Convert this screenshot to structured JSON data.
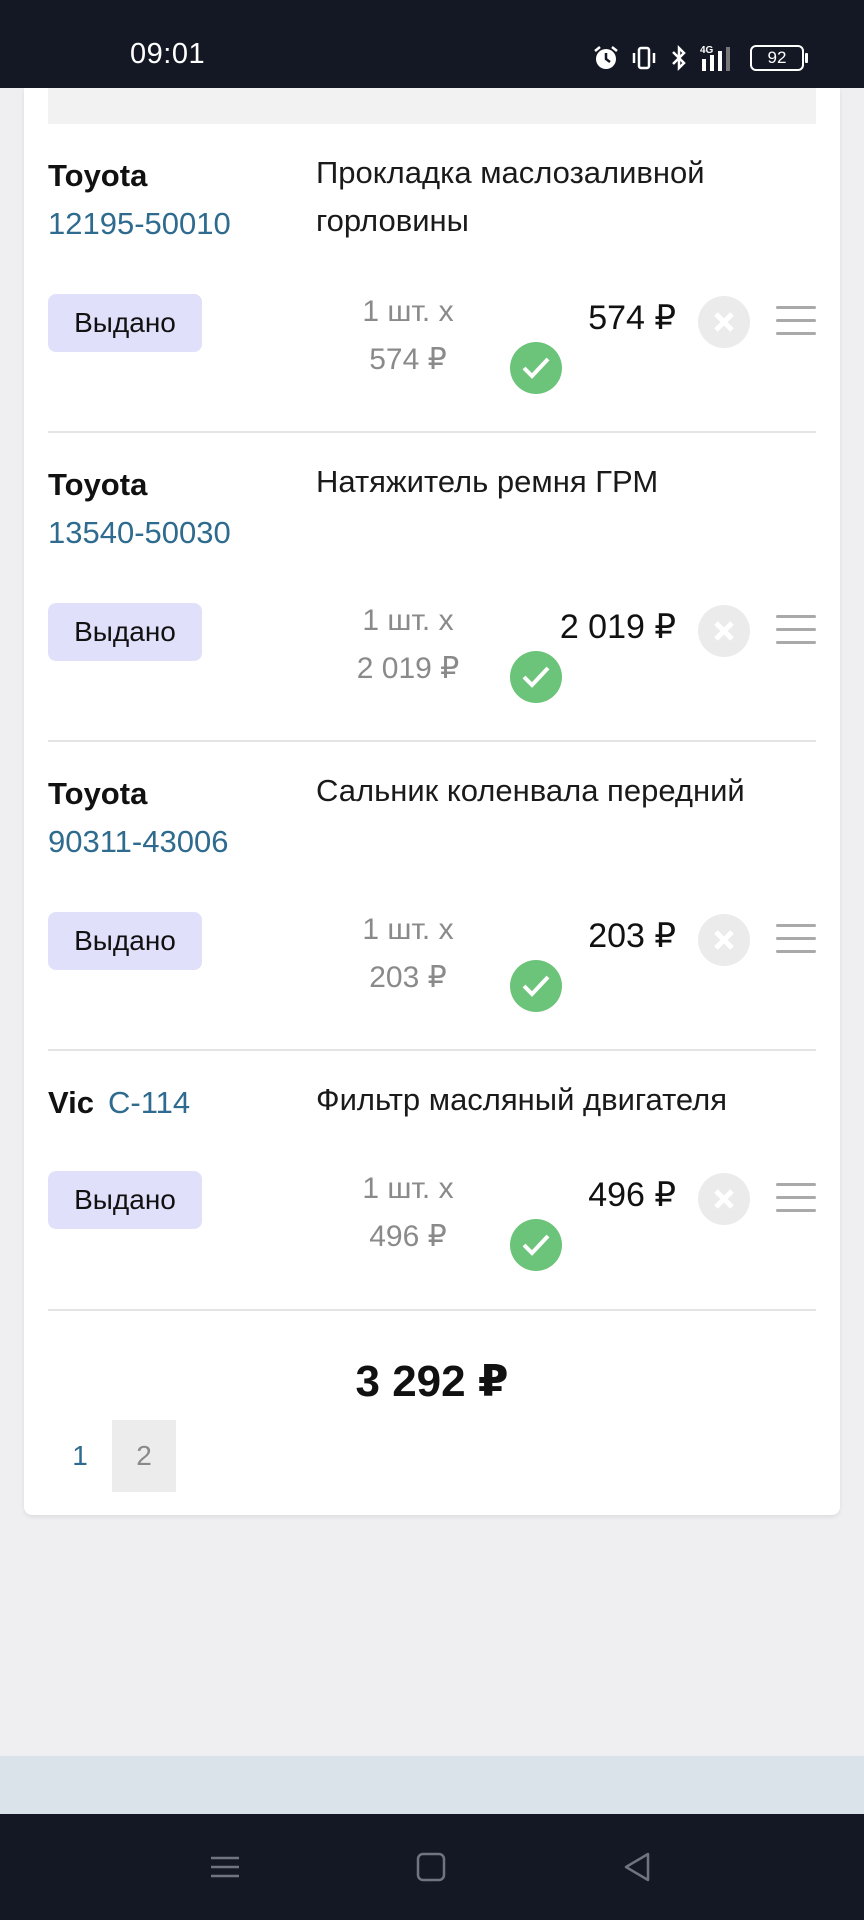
{
  "status_bar": {
    "time": "09:01",
    "battery": "92",
    "network": "4G"
  },
  "items": [
    {
      "brand": "Toyota",
      "article": "12195-50010",
      "description": "Прокладка маслозаливной горловины",
      "status": "Выдано",
      "qty_line": "1 шт. x",
      "unit_price": "574 ₽",
      "total": "574 ₽"
    },
    {
      "brand": "Toyota",
      "article": "13540-50030",
      "description": "Натяжитель ремня ГРМ",
      "status": "Выдано",
      "qty_line": "1 шт. x",
      "unit_price": "2 019 ₽",
      "total": "2 019 ₽"
    },
    {
      "brand": "Toyota",
      "article": "90311-43006",
      "description": "Сальник коленвала передний",
      "status": "Выдано",
      "qty_line": "1 шт. x",
      "unit_price": "203 ₽",
      "total": "203 ₽"
    },
    {
      "brand": "Vic",
      "article": "C-114",
      "description": "Фильтр масляный двигателя",
      "status": "Выдано",
      "qty_line": "1 шт. x",
      "unit_price": "496 ₽",
      "total": "496 ₽"
    }
  ],
  "grand_total": "3 292 ₽",
  "pagination": {
    "pages": [
      "1",
      "2"
    ],
    "current": "2"
  },
  "colors": {
    "accent": "#2e6b8f",
    "status_bg": "#e0e0fb",
    "confirm": "#6cc47a",
    "system_bar": "#141824"
  }
}
